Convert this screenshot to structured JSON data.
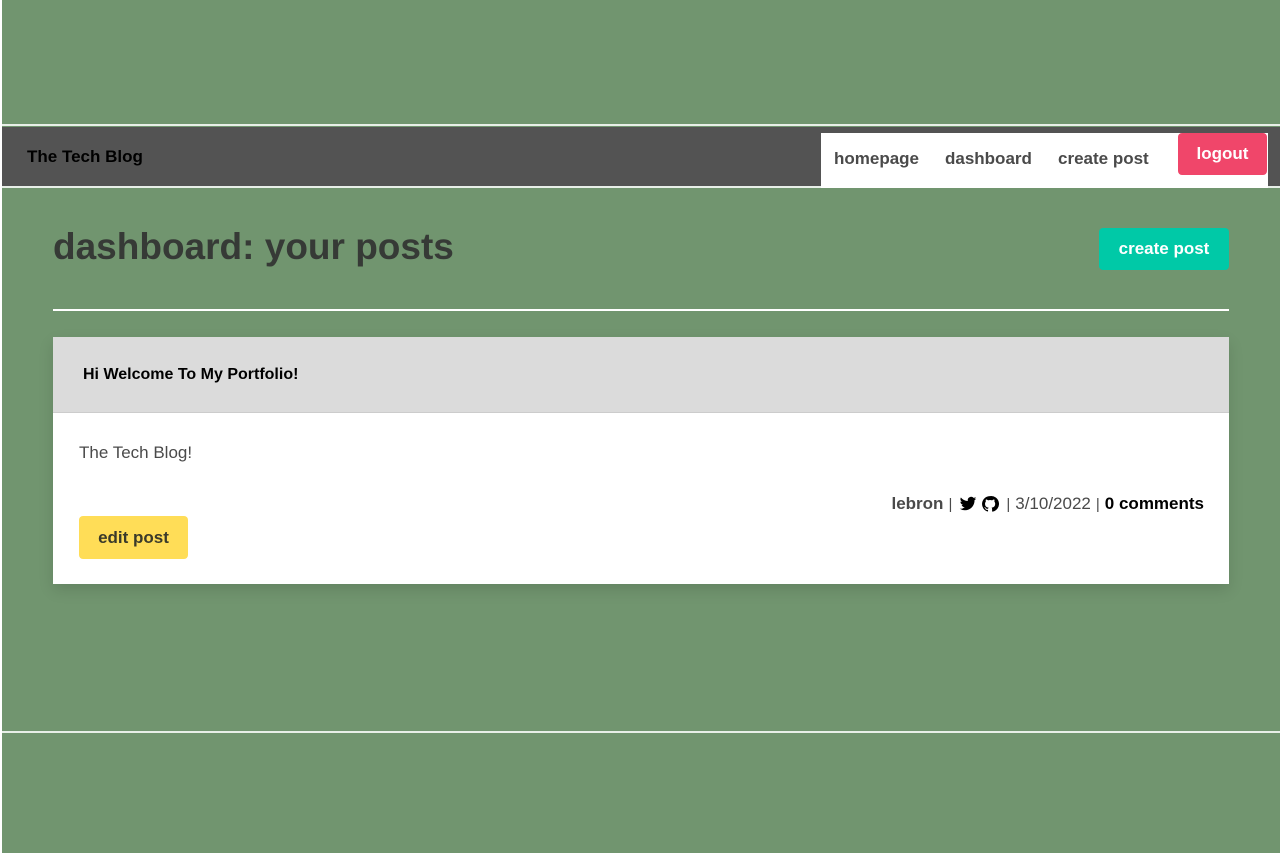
{
  "header": {
    "brand": "The Tech Blog",
    "nav": {
      "homepage": "homepage",
      "dashboard": "dashboard",
      "create_post": "create post",
      "logout": "logout"
    }
  },
  "main": {
    "title": "dashboard: your posts",
    "create_button": "create post",
    "posts": [
      {
        "title": "Hi Welcome To My Portfolio!",
        "body": "The Tech Blog!",
        "author": "lebron",
        "icons": [
          "twitter-icon",
          "github-icon"
        ],
        "date": "3/10/2022",
        "comments": "0 comments",
        "edit_button": "edit post"
      }
    ]
  },
  "colors": {
    "background": "#71956f",
    "navbar": "#535353",
    "logout": "#f0466a",
    "primary": "#00c9a7",
    "warning": "#ffdd57",
    "card_header": "#dbdbdb"
  }
}
